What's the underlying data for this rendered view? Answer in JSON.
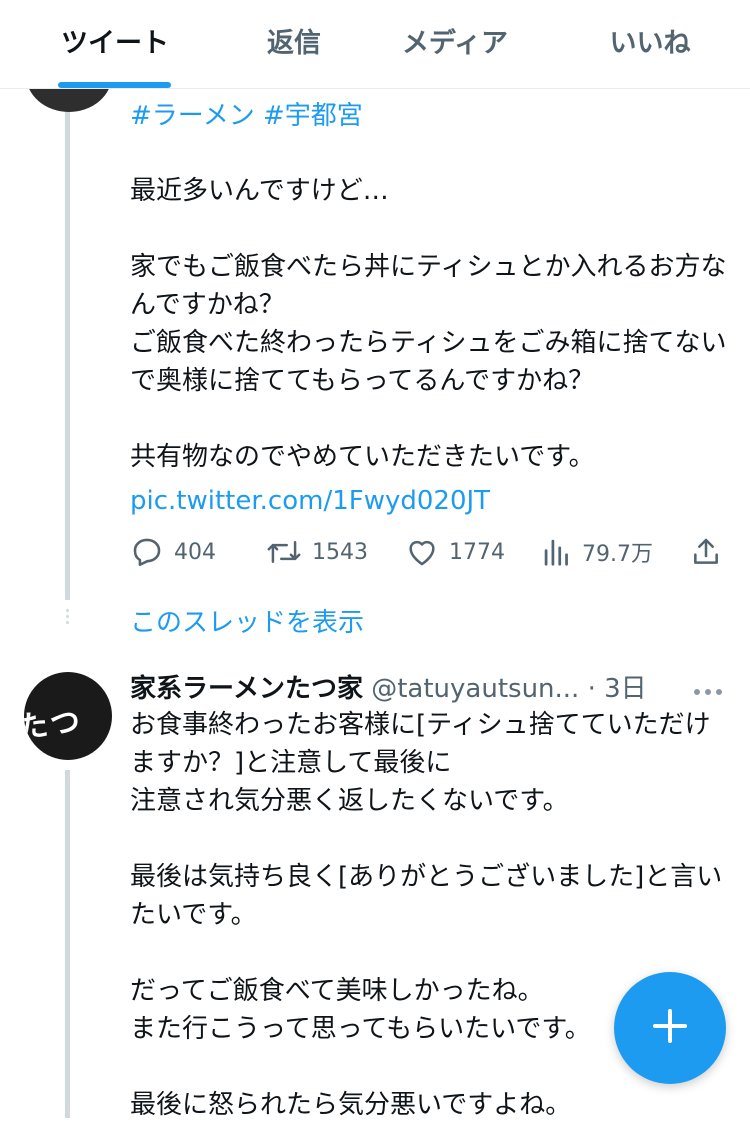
{
  "tabs": {
    "tweets": "ツイート",
    "replies": "返信",
    "media": "メディア",
    "likes": "いいね"
  },
  "tweet1": {
    "hashtags": "#ラーメン #宇都宮",
    "body": "最近多いんですけど…\n\n家でもご飯食べたら丼にティシュとか入れるお方なんですかね？\nご飯食べた終わったらティシュをごみ箱に捨てないで奥様に捨ててもらってるんですかね？\n\n共有物なのでやめていただきたいです。",
    "link": "pic.twitter.com/1Fwyd020JT",
    "replies": "404",
    "retweets": "1543",
    "likes": "1774",
    "views": "79.7万",
    "icons": [
      "reply-icon",
      "retweet-icon",
      "like-icon",
      "views-icon",
      "share-icon"
    ]
  },
  "show_thread": "このスレッドを表示",
  "tweet2": {
    "name": "家系ラーメンたつ家",
    "handle": "@tatuyautsun...",
    "time": "· 3日",
    "body": "お食事終わったお客様に[ティシュ捨てていただけますか？]と注意して最後に\n注意され気分悪く返したくないです。\n\n最後は気持ち良く[ありがとうございました]と言いたいです。\n\nだってご飯食べて美味しかったね。\nまた行こうって思ってもらいたいです。\n\n最後に怒られたら気分悪いですよね。"
  },
  "colors": {
    "accent": "#1d9bf0",
    "text": "#0f1419",
    "secondary": "#536471",
    "thread_line": "#cfd9de"
  },
  "fab_icon": "compose-plus-icon"
}
